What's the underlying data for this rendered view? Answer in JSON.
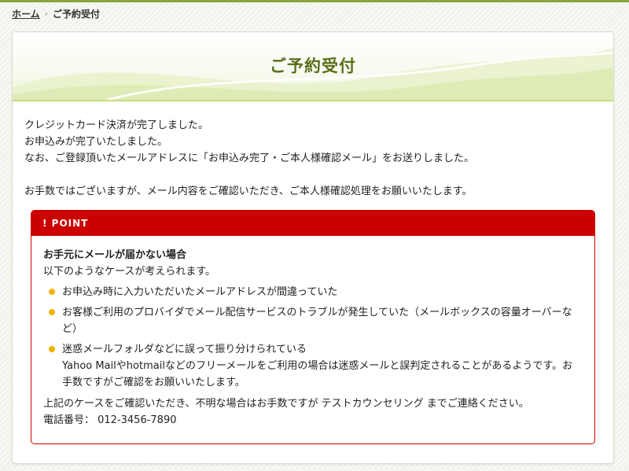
{
  "breadcrumb": {
    "home": "ホーム",
    "separator": "›",
    "current": "ご予約受付"
  },
  "page": {
    "title": "ご予約受付"
  },
  "message": {
    "line1": "クレジットカード決済が完了しました。",
    "line2": "お申込みが完了いたしました。",
    "line3": "なお、ご登録頂いたメールアドレスに「お申込み完了・ご本人様確認メール」をお送りしました。",
    "line4": "お手数ではございますが、メール内容をご確認いただき、ご本人様確認処理をお願いいたします。"
  },
  "point": {
    "header": "! POINT",
    "subtitle": "お手元にメールが届かない場合",
    "intro": "以下のようなケースが考えられます。",
    "items": [
      {
        "text": "お申込み時に入力いただいたメールアドレスが間違っていた"
      },
      {
        "text": "お客様ご利用のプロバイダでメール配信サービスのトラブルが発生していた（メールボックスの容量オーバーなど）"
      },
      {
        "text": "迷惑メールフォルダなどに誤って振り分けられている",
        "text2": "Yahoo Mailやhotmailなどのフリーメールをご利用の場合は迷惑メールと誤判定されることがあるようです。お手数ですがご確認をお願いいたします。"
      }
    ],
    "footer1": "上記のケースをご確認いただき、不明な場合はお手数ですが テストカウンセリング までご連絡ください。",
    "phone": "電話番号： 012-3456-7890"
  },
  "colors": {
    "accent_green": "#5b6f1c",
    "point_red": "#cc0000",
    "bullet": "#f0b400"
  }
}
